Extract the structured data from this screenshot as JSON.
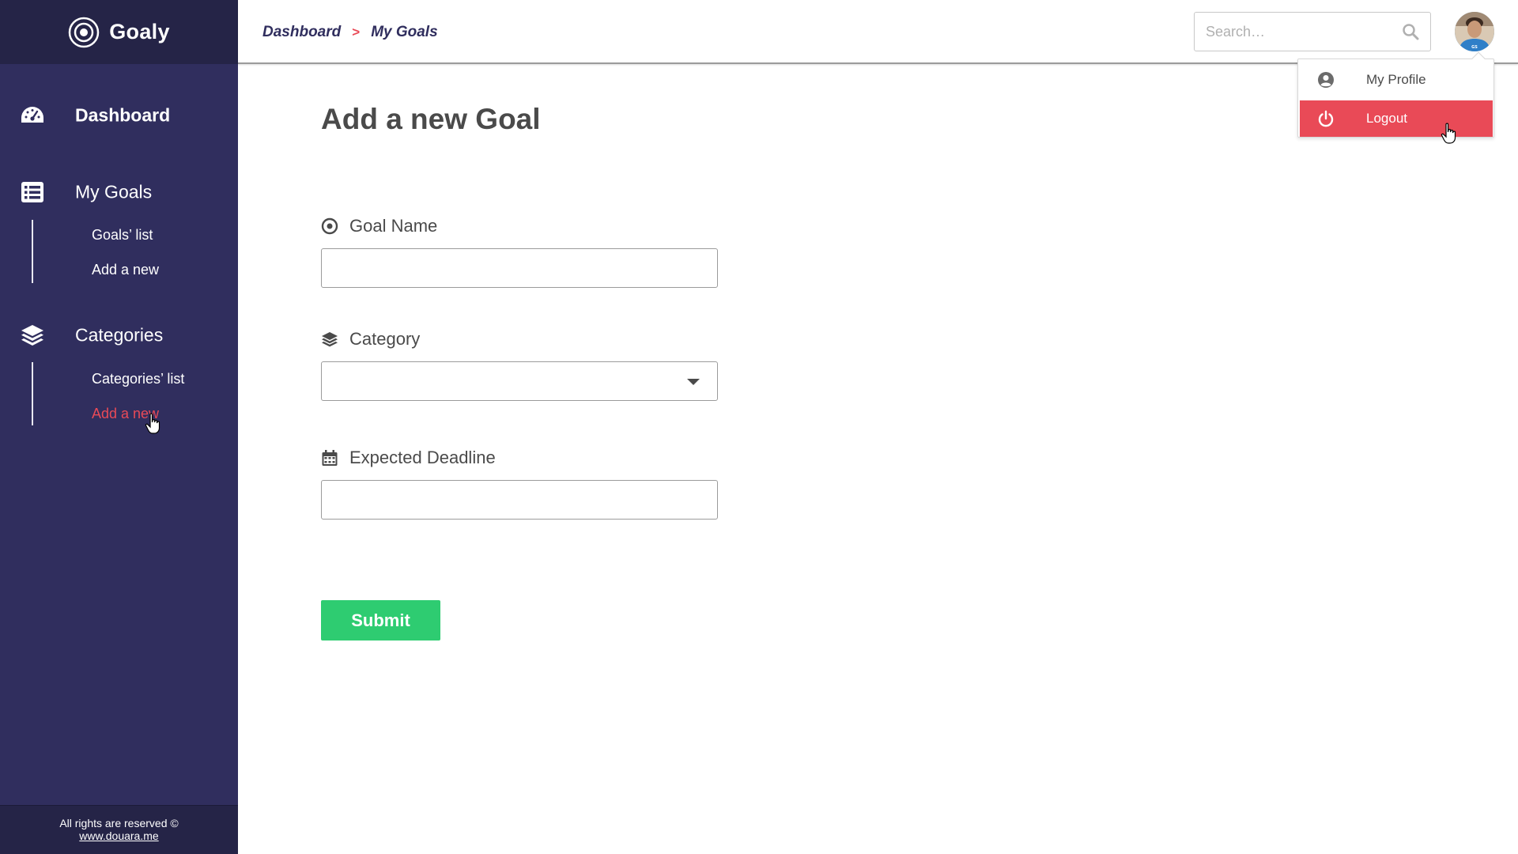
{
  "app": {
    "name": "Goaly"
  },
  "sidebar": {
    "sections": [
      {
        "label": "Dashboard",
        "icon": "dashboard-gauge-icon"
      },
      {
        "label": "My Goals",
        "icon": "list-icon",
        "items": [
          {
            "label": "Goals’ list"
          },
          {
            "label": "Add a new"
          }
        ]
      },
      {
        "label": "Categories",
        "icon": "layers-icon",
        "items": [
          {
            "label": "Categories’ list"
          },
          {
            "label": "Add a new",
            "active": true
          }
        ]
      }
    ],
    "footer": {
      "rights": "All rights are reserved ©",
      "link": "www.douara.me"
    }
  },
  "header": {
    "breadcrumb": [
      "Dashboard",
      "My Goals"
    ],
    "breadcrumb_separator": ">",
    "search": {
      "placeholder": "Search…",
      "value": ""
    }
  },
  "profile_menu": {
    "items": [
      {
        "label": "My Profile",
        "icon": "user-circle-icon"
      },
      {
        "label": "Logout",
        "icon": "power-icon"
      }
    ]
  },
  "form": {
    "title": "Add a new Goal",
    "fields": [
      {
        "label": "Goal Name",
        "icon": "target-icon",
        "value": ""
      },
      {
        "label": "Category",
        "icon": "layers-icon",
        "value": ""
      },
      {
        "label": "Expected Deadline",
        "icon": "calendar-icon",
        "value": ""
      }
    ],
    "submit_label": "Submit"
  },
  "colors": {
    "sidebar_bg": "#302e5e",
    "sidebar_dark": "#252447",
    "accent_red": "#e94a57",
    "submit_green": "#2ecc71",
    "text": "#4a4a4a"
  }
}
